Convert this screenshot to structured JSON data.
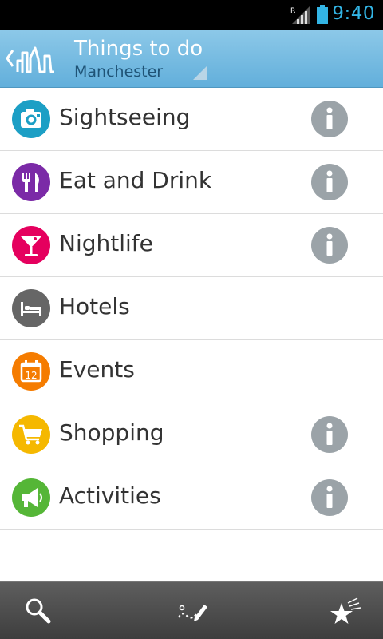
{
  "status_bar": {
    "time": "9:40",
    "roaming_indicator": "R",
    "icons": [
      "signal-icon",
      "battery-icon"
    ],
    "time_color": "#33b5e5"
  },
  "action_bar": {
    "title": "Things to do",
    "subtitle": "Manchester",
    "icons": [
      "back-chevron-icon",
      "city-skyline-icon",
      "spinner-corner-icon"
    ]
  },
  "categories": [
    {
      "label": "Sightseeing",
      "icon": "camera-icon",
      "color": "#1c9fc5",
      "has_info": true
    },
    {
      "label": "Eat and Drink",
      "icon": "fork-knife-icon",
      "color": "#7b2aa7",
      "has_info": true
    },
    {
      "label": "Nightlife",
      "icon": "cocktail-icon",
      "color": "#e5005e",
      "has_info": true
    },
    {
      "label": "Hotels",
      "icon": "bed-icon",
      "color": "#666666",
      "has_info": false
    },
    {
      "label": "Events",
      "icon": "calendar-icon",
      "color": "#f57c00",
      "has_info": false
    },
    {
      "label": "Shopping",
      "icon": "shopping-cart-icon",
      "color": "#f5b800",
      "has_info": true
    },
    {
      "label": "Activities",
      "icon": "megaphone-icon",
      "color": "#55b637",
      "has_info": true
    }
  ],
  "events_calendar_number": "12",
  "info_icon": "info-icon",
  "bottom_bar": {
    "icons": [
      "search-icon",
      "route-pencil-icon",
      "stars-icon"
    ]
  }
}
